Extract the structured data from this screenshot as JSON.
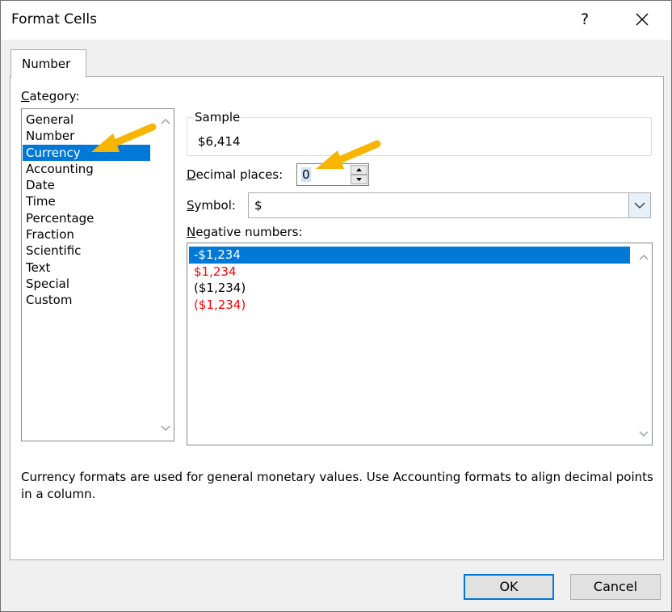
{
  "window": {
    "title": "Format Cells",
    "help_label": "?"
  },
  "tabs": [
    {
      "label": "Number",
      "active": true
    }
  ],
  "category": {
    "label": "Category:",
    "items": [
      "General",
      "Number",
      "Currency",
      "Accounting",
      "Date",
      "Time",
      "Percentage",
      "Fraction",
      "Scientific",
      "Text",
      "Special",
      "Custom"
    ],
    "selected_index": 2
  },
  "sample": {
    "label": "Sample",
    "value": "$6,414"
  },
  "decimal_places": {
    "label": "Decimal places:",
    "value": "0"
  },
  "symbol": {
    "label": "Symbol:",
    "value": "$"
  },
  "negative_numbers": {
    "label": "Negative numbers:",
    "items": [
      {
        "text": "-$1,234",
        "red": false,
        "selected": true
      },
      {
        "text": "$1,234",
        "red": true,
        "selected": false
      },
      {
        "text": "($1,234)",
        "red": false,
        "selected": false
      },
      {
        "text": "($1,234)",
        "red": true,
        "selected": false
      }
    ]
  },
  "description": "Currency formats are used for general monetary values.  Use Accounting formats to align decimal points in a column.",
  "buttons": {
    "ok": "OK",
    "cancel": "Cancel"
  },
  "colors": {
    "selection": "#0078d7",
    "negative_red": "#ff0000",
    "annotation_arrow": "#f7b500"
  },
  "icons": {
    "close": "close-icon",
    "help": "help-icon",
    "scroll_up": "chevron-up-icon",
    "scroll_down": "chevron-down-icon",
    "dropdown": "chevron-down-icon",
    "annotation": "arrow-annotation-icon"
  }
}
